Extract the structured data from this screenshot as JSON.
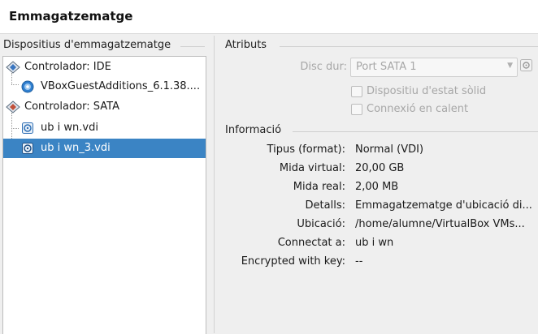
{
  "header": {
    "title": "Emmagatzematge"
  },
  "storage": {
    "group_title": "Dispositius d'emmagatzematge",
    "items": [
      {
        "label": "Controlador: IDE",
        "icon": "ide-controller-icon"
      },
      {
        "label": "VBoxGuestAdditions_6.1.38....",
        "icon": "optical-disc-icon"
      },
      {
        "label": "Controlador: SATA",
        "icon": "sata-controller-icon"
      },
      {
        "label": "ub i wn.vdi",
        "icon": "hard-disk-icon"
      },
      {
        "label": "ub i wn_3.vdi",
        "icon": "hard-disk-icon",
        "selected": true
      }
    ]
  },
  "attributes": {
    "group_title": "Atributs",
    "hard_disk_label": "Disc dur:",
    "hard_disk_value": "Port SATA 1",
    "ssd_label": "Dispositiu d'estat sòlid",
    "hotplug_label": "Connexió en calent"
  },
  "information": {
    "group_title": "Informació",
    "rows": [
      {
        "label": "Tipus (format):",
        "value": "Normal (VDI)"
      },
      {
        "label": "Mida virtual:",
        "value": "20,00 GB"
      },
      {
        "label": "Mida real:",
        "value": "2,00 MB"
      },
      {
        "label": "Detalls:",
        "value": "Emmagatzematge d'ubicació di..."
      },
      {
        "label": "Ubicació:",
        "value": "/home/alumne/VirtualBox VMs..."
      },
      {
        "label": "Connectat a:",
        "value": "ub i wn"
      },
      {
        "label": "Encrypted with key:",
        "value": "--"
      }
    ]
  },
  "colors": {
    "selection": "#3b84c4",
    "disc_blue": "#2f7fd0"
  }
}
